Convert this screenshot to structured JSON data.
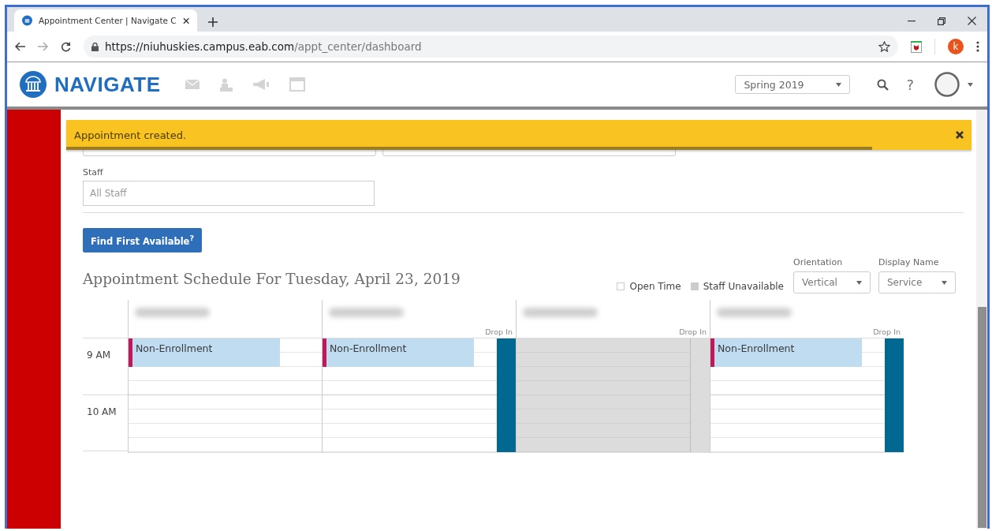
{
  "browser": {
    "tab_title": "Appointment Center | Navigate C",
    "url_host": "https://niuhuskies.campus.eab.com",
    "url_path": "/appt_center/dashboard",
    "profile_initial": "k"
  },
  "header": {
    "brand": "NAVIGATE",
    "term": "Spring 2019",
    "help": "?"
  },
  "toast": {
    "message": "Appointment created.",
    "level": 0.89
  },
  "staff_field": {
    "label": "Staff",
    "placeholder": "All Staff"
  },
  "find_button": "Find First Available$^{?}$",
  "schedule": {
    "title": "Appointment Schedule For Tuesday, April 23, 2019",
    "legend": [
      {
        "kind": "open",
        "label": "Open Time"
      },
      {
        "kind": "unavailable",
        "label": "Staff Unavailable"
      }
    ],
    "selects": [
      {
        "label": "Orientation",
        "value": "Vertical"
      },
      {
        "label": "Display Name",
        "value": "Service"
      }
    ],
    "times": [
      "9 AM",
      "10 AM"
    ],
    "columns": [
      {
        "unavailable": false,
        "appointments": [
          "Non-Enrollment"
        ]
      },
      {
        "unavailable": false,
        "drop_in_label": "Drop In",
        "appointments": [
          "Non-Enrollment"
        ]
      },
      {
        "unavailable": true,
        "drop_in_label": "Drop In"
      },
      {
        "unavailable": false,
        "drop_in_label": "Drop In",
        "appointments": [
          "Non-Enrollment"
        ]
      }
    ]
  }
}
